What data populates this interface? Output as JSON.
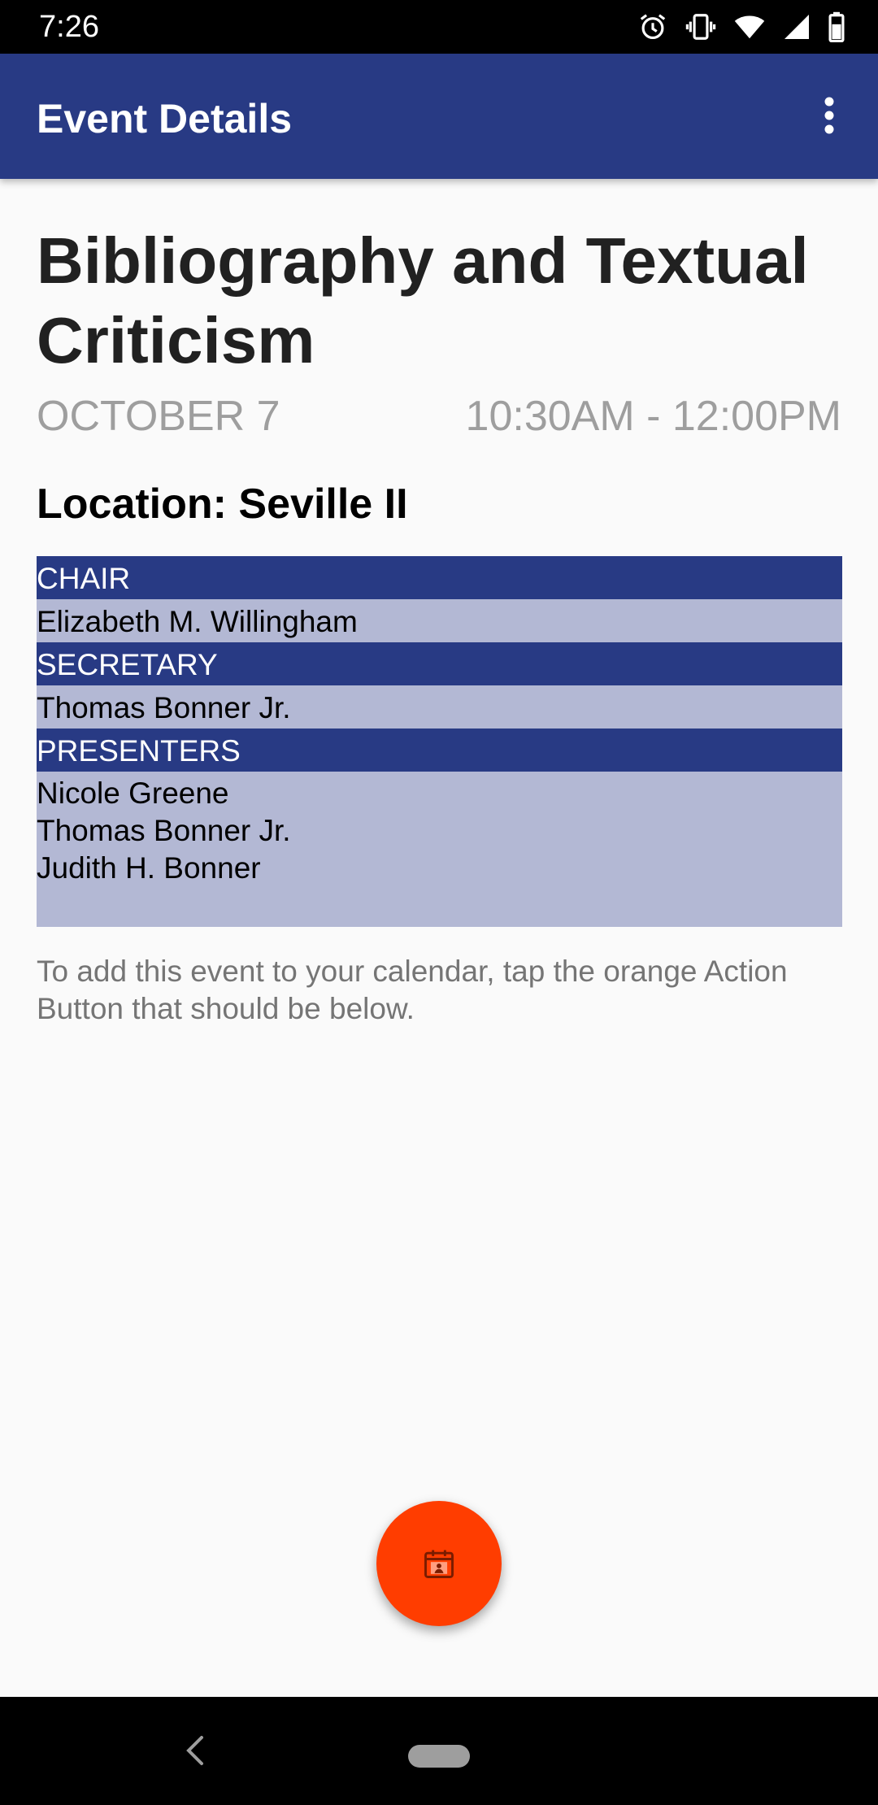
{
  "status_bar": {
    "time": "7:26",
    "icons": [
      "alarm-icon",
      "vibrate-icon",
      "wifi-icon",
      "signal-icon",
      "battery-icon"
    ]
  },
  "app_bar": {
    "title": "Event Details",
    "menu_icon": "more-vert-icon",
    "color": "#283a84"
  },
  "event": {
    "title": "Bibliography and Textual Criticism",
    "date": "OCTOBER 7",
    "time": "10:30AM - 12:00PM",
    "location": "Location: Seville II"
  },
  "roles": {
    "chair_label": "CHAIR",
    "chair": "Elizabeth M. Willingham",
    "secretary_label": "SECRETARY",
    "secretary": "Thomas Bonner Jr.",
    "presenters_label": "PRESENTERS",
    "presenters": [
      "Nicole Greene",
      "Thomas Bonner Jr.",
      "Judith H. Bonner"
    ]
  },
  "instruction": "To add this event to your calendar, tap the orange Action Button that should be below.",
  "fab": {
    "icon": "add-to-calendar-icon",
    "color": "#ff3d00"
  },
  "nav_bar": {
    "back_icon": "back-icon",
    "home_icon": "home-pill-icon"
  }
}
